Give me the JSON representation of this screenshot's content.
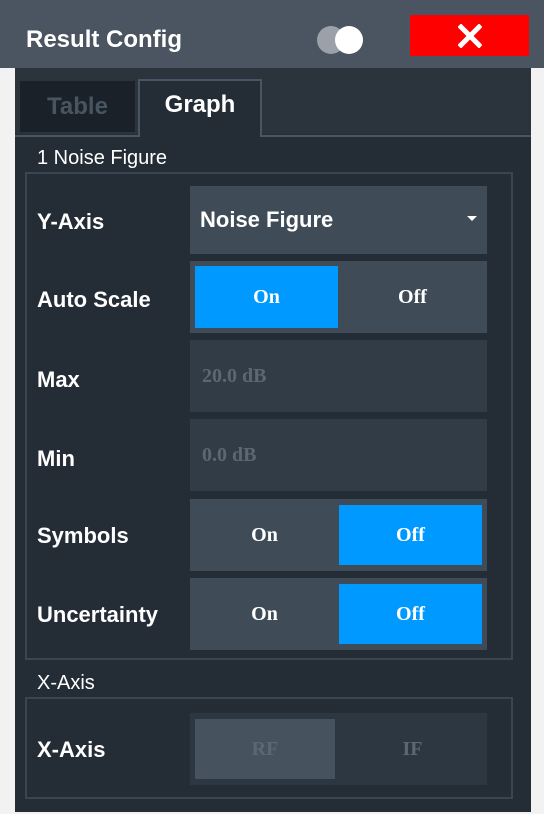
{
  "dialog": {
    "title": "Result Config",
    "close_icon": "close-x-icon",
    "toggle_icon": "view-toggle-icon"
  },
  "tabs": [
    {
      "label": "Table",
      "active": false
    },
    {
      "label": "Graph",
      "active": true
    }
  ],
  "noise_figure": {
    "section_label": "1 Noise Figure",
    "y_axis": {
      "label": "Y-Axis",
      "value": "Noise Figure"
    },
    "auto_scale": {
      "label": "Auto Scale",
      "on": "On",
      "off": "Off",
      "selected": "On"
    },
    "max": {
      "label": "Max",
      "value": "20.0 dB"
    },
    "min": {
      "label": "Min",
      "value": "0.0 dB"
    },
    "symbols": {
      "label": "Symbols",
      "on": "On",
      "off": "Off",
      "selected": "Off"
    },
    "uncertainty": {
      "label": "Uncertainty",
      "on": "On",
      "off": "Off",
      "selected": "Off"
    }
  },
  "x_axis": {
    "section_label": "X-Axis",
    "label": "X-Axis",
    "rf": "RF",
    "if": "IF"
  },
  "colors": {
    "accent": "#0099ff",
    "close": "#ff0000",
    "titlebar": "#4a5561",
    "panel": "#242d35"
  }
}
